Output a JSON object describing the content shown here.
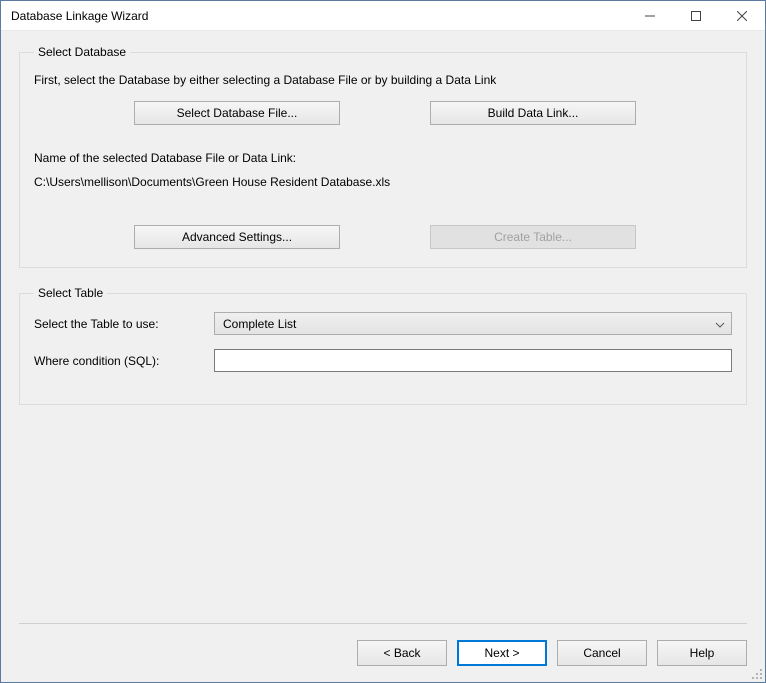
{
  "window": {
    "title": "Database Linkage Wizard"
  },
  "selectDatabase": {
    "legend": "Select Database",
    "instruction": "First, select the Database by either selecting a Database File or by building a Data Link",
    "selectFileButton": "Select Database File...",
    "buildDataLinkButton": "Build Data Link...",
    "nameLabel": "Name of the selected Database File or Data Link:",
    "filePath": "C:\\Users\\mellison\\Documents\\Green House Resident Database.xls",
    "advancedSettingsButton": "Advanced Settings...",
    "createTableButton": "Create Table..."
  },
  "selectTable": {
    "legend": "Select Table",
    "tableLabel": "Select the Table to use:",
    "tableValue": "Complete List",
    "whereLabel": "Where condition (SQL):",
    "whereValue": ""
  },
  "footer": {
    "back": "< Back",
    "next": "Next >",
    "cancel": "Cancel",
    "help": "Help"
  }
}
